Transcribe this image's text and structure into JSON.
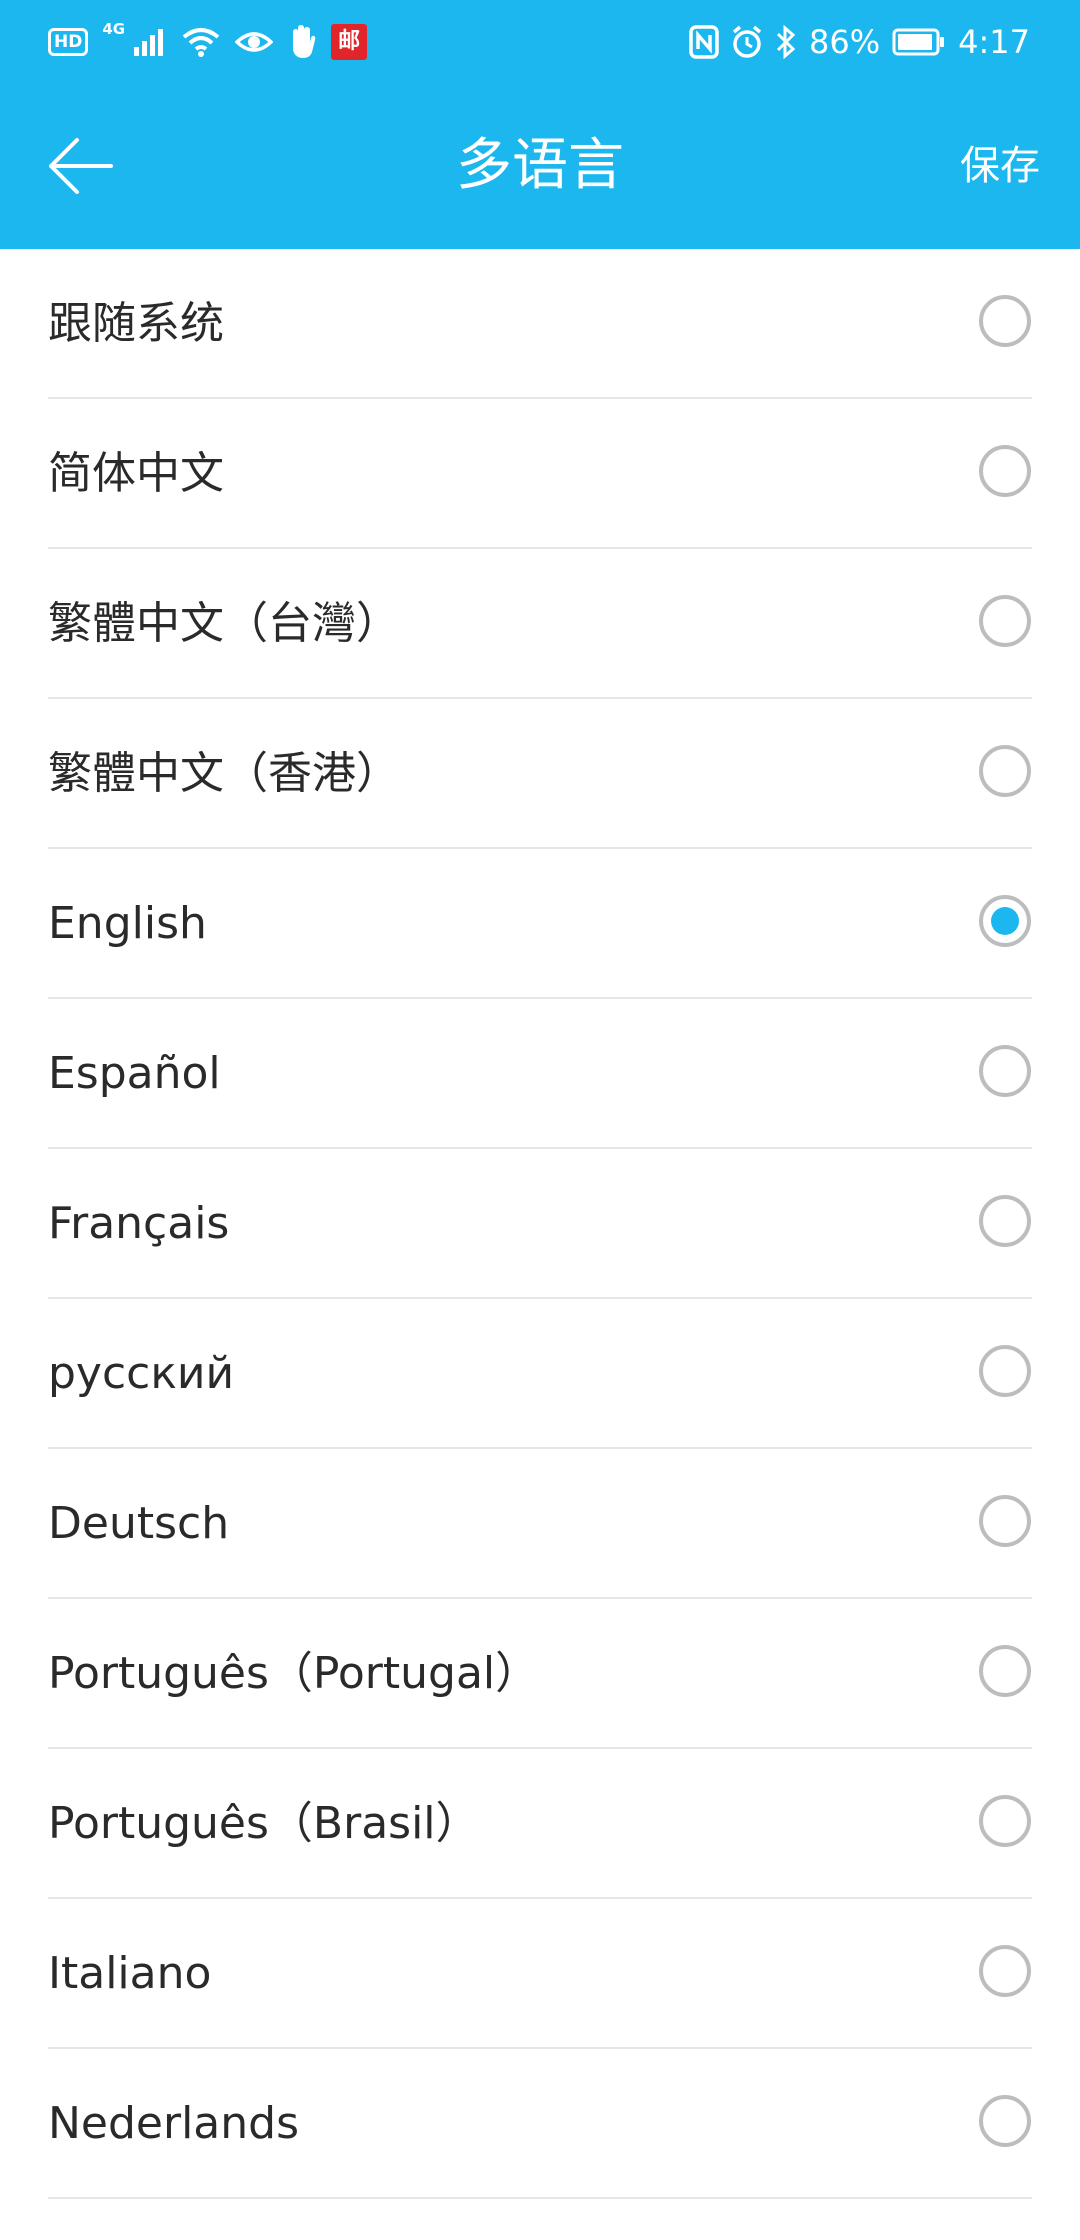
{
  "status_bar": {
    "hd_label": "HD",
    "network_label": "4G",
    "mail_badge_label": "邮",
    "battery_percent": "86%",
    "time": "4:17",
    "icons": [
      "hd-icon",
      "signal-icon",
      "wifi-icon",
      "eye-icon",
      "hand-icon",
      "mail-app-icon",
      "nfc-icon",
      "alarm-icon",
      "bluetooth-icon",
      "battery-icon"
    ]
  },
  "app_bar": {
    "back_icon": "arrow-left-icon",
    "title": "多语言",
    "save_label": "保存"
  },
  "colors": {
    "accent": "#1bb7ee",
    "text": "#2a2a2a",
    "radio_border": "#bdbdbd",
    "divider": "#e6e6e6"
  },
  "languages": [
    {
      "label": "跟随系统",
      "selected": false
    },
    {
      "label": "简体中文",
      "selected": false
    },
    {
      "label": "繁體中文（台灣）",
      "selected": false
    },
    {
      "label": "繁體中文（香港）",
      "selected": false
    },
    {
      "label": "English",
      "selected": true
    },
    {
      "label": "Español",
      "selected": false
    },
    {
      "label": "Français",
      "selected": false
    },
    {
      "label": "русский",
      "selected": false
    },
    {
      "label": "Deutsch",
      "selected": false
    },
    {
      "label": "Português（Portugal）",
      "selected": false
    },
    {
      "label": "Português（Brasil）",
      "selected": false
    },
    {
      "label": "Italiano",
      "selected": false
    },
    {
      "label": "Nederlands",
      "selected": false
    }
  ]
}
